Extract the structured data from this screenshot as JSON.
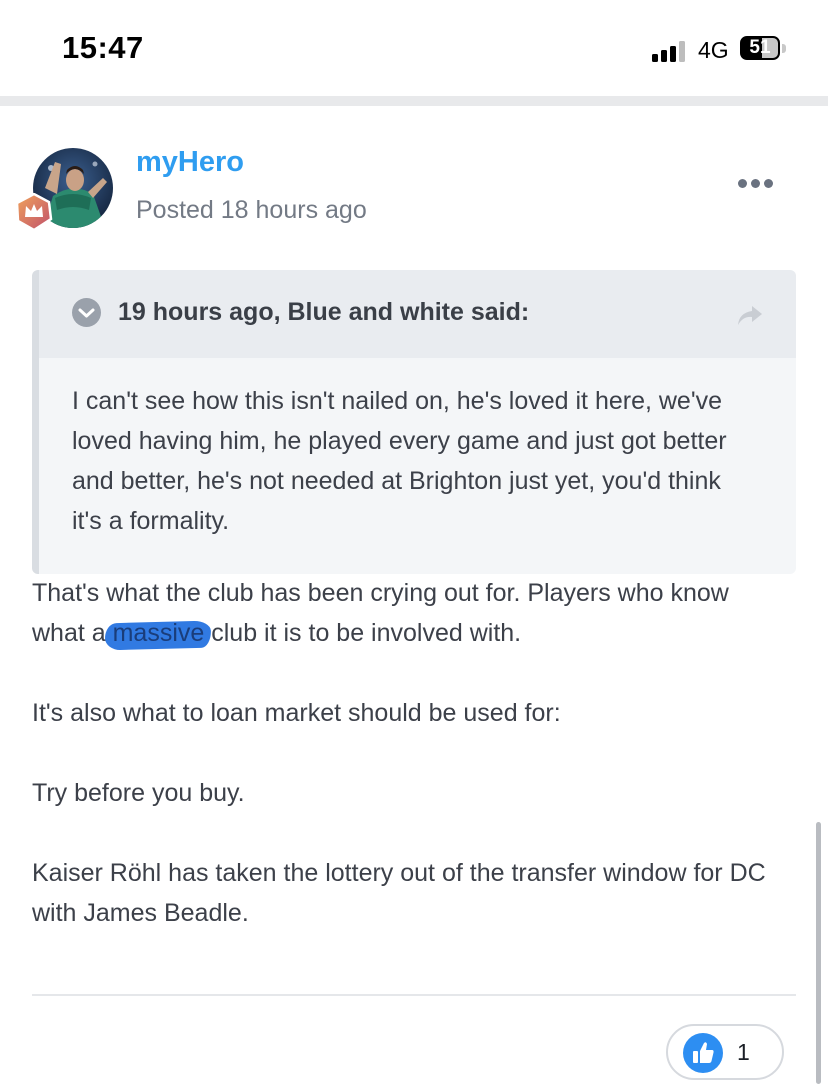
{
  "status_bar": {
    "time": "15:47",
    "network": "4G",
    "battery": "51",
    "signal_icon": "cellular-signal-icon",
    "battery_icon": "battery-icon"
  },
  "post": {
    "author": "myHero",
    "posted": "Posted 18 hours ago",
    "avatar_icon": "user-avatar",
    "rank_badge_icon": "crown-badge-icon",
    "menu_icon": "more-options-icon",
    "quote": {
      "header": "19 hours ago, Blue and white said:",
      "chevron_icon": "chevron-down-icon",
      "share_icon": "share-arrow-icon",
      "lines": [
        "I can't see how this isn't nailed on, he's loved it here, we've",
        "loved having him, he played every game and just got better",
        "and better, he's not needed at Brighton just yet, you'd think",
        "it's a formality."
      ]
    },
    "body": {
      "p1_line1": "That's what the club has been crying out for. Players who know",
      "p1_line2_before": "what a ",
      "p1_line2_highlight": "massive",
      "p1_line2_after": " club it is to be involved with.",
      "p2": "It's also what to loan market should be used for:",
      "p3": "Try before you buy.",
      "p4_line1": "Kaiser Röhl has taken the lottery out of the transfer window for DC",
      "p4_line2": "with James Beadle."
    },
    "reactions": {
      "like_icon": "thumbs-up-icon",
      "like_count": "1"
    }
  },
  "colors": {
    "author": "#2f9df0",
    "highlight": "#1f6fe0",
    "like": "#2d8ef2"
  }
}
